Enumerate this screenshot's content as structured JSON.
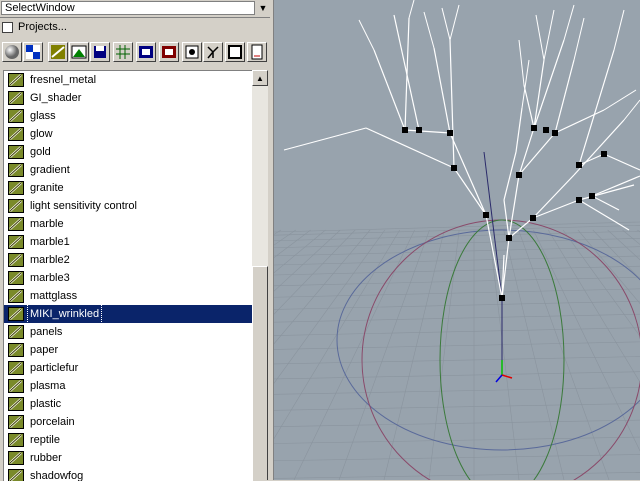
{
  "window": {
    "title": "SelectWindow"
  },
  "projects": {
    "label": "Projects..."
  },
  "toolbar": {
    "icons": [
      "sphere-icon",
      "checker-icon",
      "shader-icon",
      "landscape-icon",
      "save-icon",
      "grid-icon",
      "film-icon",
      "image-icon",
      "link-icon",
      "tree-icon",
      "frame-icon",
      "document-icon"
    ]
  },
  "shader_list": {
    "items": [
      {
        "label": "fresnel_metal"
      },
      {
        "label": "GI_shader"
      },
      {
        "label": "glass"
      },
      {
        "label": "glow"
      },
      {
        "label": "gold"
      },
      {
        "label": "gradient"
      },
      {
        "label": "granite"
      },
      {
        "label": "light sensitivity control"
      },
      {
        "label": "marble"
      },
      {
        "label": "marble1"
      },
      {
        "label": "marble2"
      },
      {
        "label": "marble3"
      },
      {
        "label": "mattglass"
      },
      {
        "label": "MIKI_wrinkled"
      },
      {
        "label": "panels"
      },
      {
        "label": "paper"
      },
      {
        "label": "particlefur"
      },
      {
        "label": "plasma"
      },
      {
        "label": "plastic"
      },
      {
        "label": "porcelain"
      },
      {
        "label": "reptile"
      },
      {
        "label": "rubber"
      },
      {
        "label": "shadowfog"
      }
    ],
    "selected_label": "MIKI_wrinkled"
  },
  "colors": {
    "selection": "#0a246a",
    "viewport_bg": "#98a3ad",
    "grid": "#8a949e"
  }
}
